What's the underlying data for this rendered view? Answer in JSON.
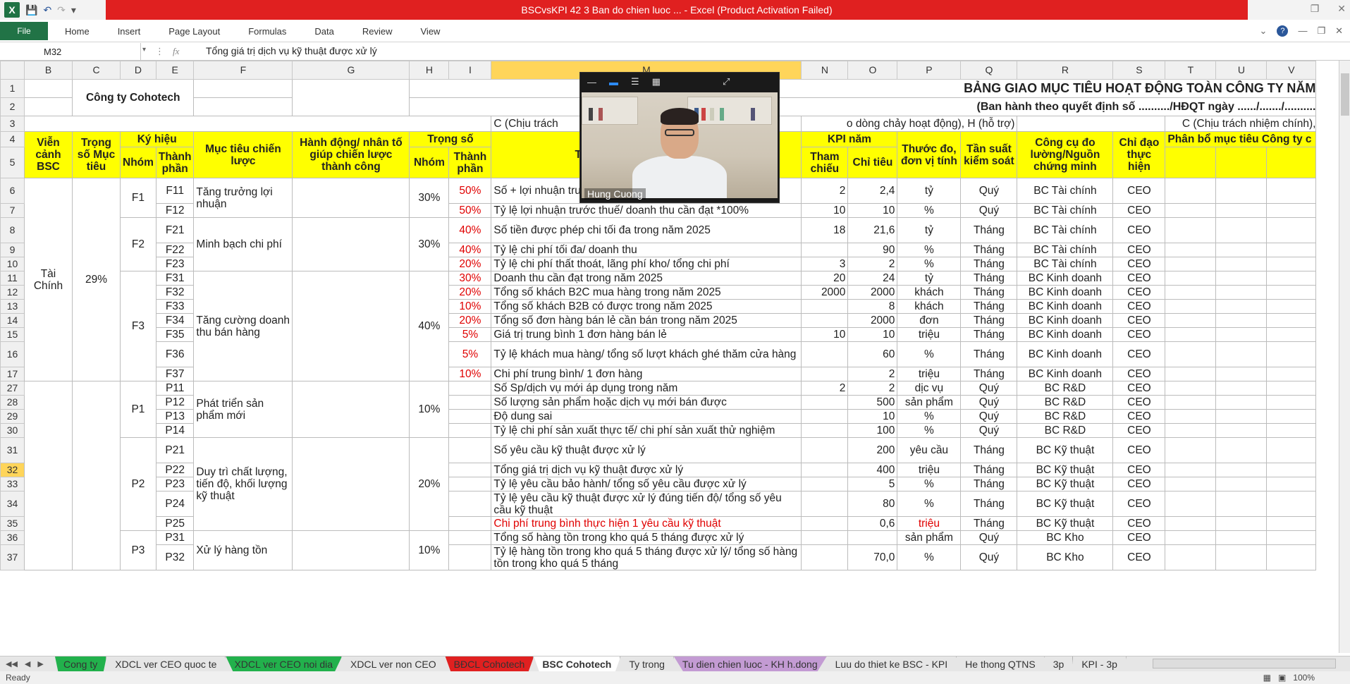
{
  "window": {
    "title": "BSCvsKPI 42 3 Ban do chien luoc ... - Excel (Product Activation Failed)",
    "qat_icons": [
      "excel-icon",
      "save-icon",
      "undo-icon",
      "redo-icon",
      "customize-icon"
    ]
  },
  "ribbon": {
    "file": "File",
    "tabs": [
      "Home",
      "Insert",
      "Page Layout",
      "Formulas",
      "Data",
      "Review",
      "View"
    ]
  },
  "formula": {
    "cell": "M32",
    "value": "Tổng giá trị dịch vụ kỹ thuật được xử lý"
  },
  "columns": [
    "B",
    "C",
    "D",
    "E",
    "F",
    "G",
    "H",
    "I",
    "M",
    "N",
    "O",
    "P",
    "Q",
    "R",
    "S",
    "T",
    "U",
    "V"
  ],
  "sheet": {
    "company": "Công ty Cohotech",
    "main_title": "BẢNG GIAO MỤC TIÊU HOẠT ĐỘNG TOÀN CÔNG TY NĂM",
    "sub_title": "(Ban hành theo quyết định số ........../HĐQT ngày ....../......./..........",
    "note_row3_left": "C (Chịu trách",
    "note_row3_mid": "o dòng chảy hoạt động), H (hỗ trợ)",
    "note_row3_right": "C (Chịu trách nhiệm chính),",
    "headers": {
      "vien_canh": "Viễn cảnh BSC",
      "trong_so_muc_tieu": "Trọng số Mục tiêu",
      "ky_hieu": "Ký hiệu",
      "nhom": "Nhóm",
      "thanh_phan": "Thành phần",
      "muc_tieu": "Mục tiêu chiến lược",
      "hanh_dong": "Hành động/ nhân tố giúp chiến lược thành công",
      "trong_so": "Trọng số",
      "ts_nhom": "Nhóm",
      "ts_thanh_phan": "Thành phần",
      "tieu_chi": "Tiêu chí - thước đo/ tên KPI",
      "kpi_nam": "KPI năm",
      "tham_chieu": "Tham chiếu",
      "chi_tieu": "Chỉ tiêu",
      "thuoc_do": "Thước đo, đơn vị tính",
      "tan_suat": "Tần suất kiểm soát",
      "cong_cu": "Công cụ đo lường/Nguồn chứng minh",
      "chi_dao": "Chỉ đạo thực hiện",
      "phan_bo": "Phân bổ mục tiêu Công ty c"
    },
    "groups": {
      "tai_chinh": "Tài Chính",
      "tai_chinh_weight": "29%",
      "F1": "F1",
      "F1_goal": "Tăng trưởng lợi nhuận",
      "F1_w": "30%",
      "F2": "F2",
      "F2_goal": "Minh bạch chi phí",
      "F2_w": "30%",
      "F3": "F3",
      "F3_goal": "Tăng cường doanh thu bán hàng",
      "F3_w": "40%",
      "P1": "P1",
      "P1_goal": "Phát triển sản phẩm mới",
      "P1_w": "10%",
      "P2": "P2",
      "P2_goal": "Duy trì chất lượng, tiến độ, khối lượng kỹ thuật",
      "P2_w": "20%",
      "P3": "P3",
      "P3_goal": "Xử lý hàng tồn",
      "P3_w": "10%"
    },
    "rows": [
      {
        "n": "6",
        "code": "F11",
        "tp": "50%",
        "kpi": "Số + lợi nhuận trước thuế cần đạt trong năm 2025",
        "tc": "2",
        "ct": "2,4",
        "dv": "tỷ",
        "ts": "Quý",
        "cc": "BC Tài chính",
        "cd": "CEO"
      },
      {
        "n": "7",
        "code": "F12",
        "tp": "50%",
        "kpi": "Tỷ lệ lợi nhuận trước thuế/ doanh thu cần đạt *100%",
        "tc": "10",
        "ct": "10",
        "dv": "%",
        "ts": "Quý",
        "cc": "BC Tài chính",
        "cd": "CEO"
      },
      {
        "n": "8",
        "code": "F21",
        "tp": "40%",
        "kpi": "Số tiền được phép chi tối đa trong năm 2025",
        "tc": "18",
        "ct": "21,6",
        "dv": "tỷ",
        "ts": "Tháng",
        "cc": "BC Tài chính",
        "cd": "CEO"
      },
      {
        "n": "9",
        "code": "F22",
        "tp": "40%",
        "kpi": "Tỷ lệ chi phí tối đa/ doanh thu",
        "tc": "",
        "ct": "90",
        "dv": "%",
        "ts": "Tháng",
        "cc": "BC Tài chính",
        "cd": "CEO"
      },
      {
        "n": "10",
        "code": "F23",
        "tp": "20%",
        "kpi": "Tỷ lệ chi phí thất thoát, lãng phí kho/ tổng chi phí",
        "tc": "3",
        "ct": "2",
        "dv": "%",
        "ts": "Tháng",
        "cc": "BC Tài chính",
        "cd": "CEO"
      },
      {
        "n": "11",
        "code": "F31",
        "tp": "30%",
        "kpi": "Doanh thu cần đạt trong năm 2025",
        "tc": "20",
        "ct": "24",
        "dv": "tỷ",
        "ts": "Tháng",
        "cc": "BC Kinh doanh",
        "cd": "CEO"
      },
      {
        "n": "12",
        "code": "F32",
        "tp": "20%",
        "kpi": "Tổng số khách B2C mua hàng trong năm 2025",
        "tc": "2000",
        "ct": "2000",
        "dv": "khách",
        "ts": "Tháng",
        "cc": "BC Kinh doanh",
        "cd": "CEO"
      },
      {
        "n": "13",
        "code": "F33",
        "tp": "10%",
        "kpi": "Tổng số khách B2B có được trong năm 2025",
        "tc": "",
        "ct": "8",
        "dv": "khách",
        "ts": "Tháng",
        "cc": "BC Kinh doanh",
        "cd": "CEO"
      },
      {
        "n": "14",
        "code": "F34",
        "tp": "20%",
        "kpi": "Tổng số đơn hàng bán lẻ cần bán trong năm 2025",
        "tc": "",
        "ct": "2000",
        "dv": "đơn",
        "ts": "Tháng",
        "cc": "BC Kinh doanh",
        "cd": "CEO"
      },
      {
        "n": "15",
        "code": "F35",
        "tp": "5%",
        "kpi": "Giá trị trung bình 1 đơn hàng bán lẻ",
        "tc": "10",
        "ct": "10",
        "dv": "triệu",
        "ts": "Tháng",
        "cc": "BC Kinh doanh",
        "cd": "CEO"
      },
      {
        "n": "16",
        "code": "F36",
        "tp": "5%",
        "kpi": "Tỷ lệ khách mua hàng/ tổng số lượt khách ghé thăm cửa hàng",
        "tc": "",
        "ct": "60",
        "dv": "%",
        "ts": "Tháng",
        "cc": "BC Kinh doanh",
        "cd": "CEO"
      },
      {
        "n": "17",
        "code": "F37",
        "tp": "10%",
        "kpi": "Chi phí trung bình/ 1 đơn hàng",
        "tc": "",
        "ct": "2",
        "dv": "triệu",
        "ts": "Tháng",
        "cc": "BC Kinh doanh",
        "cd": "CEO"
      },
      {
        "n": "27",
        "code": "P11",
        "tp": "",
        "kpi": "Số Sp/dịch vụ mới áp dụng trong năm",
        "tc": "2",
        "ct": "2",
        "dv": "dịc vụ",
        "ts": "Quý",
        "cc": "BC R&D",
        "cd": "CEO"
      },
      {
        "n": "28",
        "code": "P12",
        "tp": "",
        "kpi": "Số lượng sản phẩm hoặc dịch vụ mới bán được",
        "tc": "",
        "ct": "500",
        "dv": "sản phẩm",
        "ts": "Quý",
        "cc": "BC R&D",
        "cd": "CEO"
      },
      {
        "n": "29",
        "code": "P13",
        "tp": "",
        "kpi": "Độ dung sai",
        "tc": "",
        "ct": "10",
        "dv": "%",
        "ts": "Quý",
        "cc": "BC R&D",
        "cd": "CEO"
      },
      {
        "n": "30",
        "code": "P14",
        "tp": "",
        "kpi": "Tỷ lệ chi phí sản xuất thực tế/ chi phí sản xuất thử nghiệm",
        "tc": "",
        "ct": "100",
        "dv": "%",
        "ts": "Quý",
        "cc": "BC R&D",
        "cd": "CEO"
      },
      {
        "n": "31",
        "code": "P21",
        "tp": "",
        "kpi": "Số yêu cầu kỹ thuật được xử lý",
        "tc": "",
        "ct": "200",
        "dv": "yêu cầu",
        "ts": "Tháng",
        "cc": "BC Kỹ thuật",
        "cd": "CEO"
      },
      {
        "n": "32",
        "code": "P22",
        "tp": "",
        "kpi": "Tổng giá trị dịch vụ kỹ thuật được xử lý",
        "tc": "",
        "ct": "400",
        "dv": "triệu",
        "ts": "Tháng",
        "cc": "BC Kỹ thuật",
        "cd": "CEO"
      },
      {
        "n": "33",
        "code": "P23",
        "tp": "",
        "kpi": "Tỷ lệ yêu cầu bảo hành/ tổng số yêu cầu được xử lý",
        "tc": "",
        "ct": "5",
        "dv": "%",
        "ts": "Tháng",
        "cc": "BC Kỹ thuật",
        "cd": "CEO"
      },
      {
        "n": "34",
        "code": "P24",
        "tp": "",
        "kpi": "Tỷ lệ yêu cầu kỹ thuật được xử lý đúng tiến độ/ tổng số yêu cầu kỹ thuật",
        "tc": "",
        "ct": "80",
        "dv": "%",
        "ts": "Tháng",
        "cc": "BC Kỹ thuật",
        "cd": "CEO"
      },
      {
        "n": "35",
        "code": "P25",
        "tp": "",
        "kpi": "Chi phí trung bình thực hiện 1 yêu cầu kỹ thuật",
        "tc": "",
        "ct": "0,6",
        "dv": "triệu",
        "ts": "Tháng",
        "cc": "BC Kỹ thuật",
        "cd": "CEO"
      },
      {
        "n": "36",
        "code": "P31",
        "tp": "",
        "kpi": "Tổng số hàng tồn trong kho quá 5 tháng được xử lý",
        "tc": "",
        "ct": "",
        "dv": "sản phẩm",
        "ts": "Quý",
        "cc": "BC Kho",
        "cd": "CEO"
      },
      {
        "n": "37",
        "code": "P32",
        "tp": "",
        "kpi": "Tỷ lệ hàng tồn trong kho quá 5 tháng được xử lý/ tổng số hàng tồn trong kho quá 5 tháng",
        "tc": "",
        "ct": "70,0",
        "dv": "%",
        "ts": "Quý",
        "cc": "BC Kho",
        "cd": "CEO"
      }
    ]
  },
  "video": {
    "name": "Hung Cuong"
  },
  "sheet_tabs": [
    {
      "label": "Cong ty",
      "color": "#22b14c"
    },
    {
      "label": "XDCL ver CEO quoc te",
      "color": ""
    },
    {
      "label": "XDCL ver CEO noi dia",
      "color": "#22b14c"
    },
    {
      "label": "XDCL ver non CEO",
      "color": ""
    },
    {
      "label": "BĐCL Cohotech",
      "color": "#e02020"
    },
    {
      "label": "BSC Cohotech",
      "color": "",
      "active": true
    },
    {
      "label": "Ty trong",
      "color": ""
    },
    {
      "label": "Tu dien chien luoc - KH h.dong",
      "color": "#c39bd3"
    },
    {
      "label": "Luu do thiet ke BSC - KPI",
      "color": ""
    },
    {
      "label": "He thong QTNS",
      "color": ""
    },
    {
      "label": "3p",
      "color": ""
    },
    {
      "label": "KPI - 3p",
      "color": ""
    }
  ],
  "status": {
    "ready": "Ready",
    "zoom": "100%"
  }
}
